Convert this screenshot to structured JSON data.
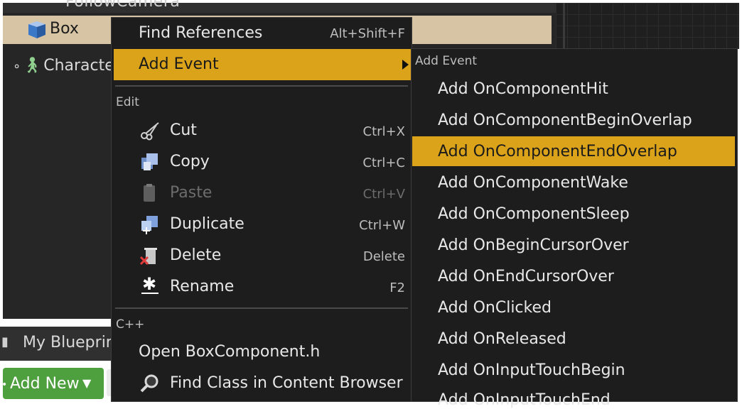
{
  "components": {
    "prev_item": "FollowCamera",
    "box": "Box",
    "character": "Character"
  },
  "my_blueprint_tab": "My Blueprin",
  "add_new_button": "Add New",
  "context_menu": {
    "find_references": {
      "label": "Find References",
      "shortcut": "Alt+Shift+F"
    },
    "add_event": {
      "label": "Add Event"
    },
    "edit_header": "Edit",
    "edit_items": [
      {
        "label": "Cut",
        "shortcut": "Ctrl+X",
        "icon": "scissors-icon"
      },
      {
        "label": "Copy",
        "shortcut": "Ctrl+C",
        "icon": "copy-icon"
      },
      {
        "label": "Paste",
        "shortcut": "Ctrl+V",
        "icon": "clipboard-icon",
        "disabled": true
      },
      {
        "label": "Duplicate",
        "shortcut": "Ctrl+W",
        "icon": "duplicate-icon"
      },
      {
        "label": "Delete",
        "shortcut": "Delete",
        "icon": "trash-icon"
      },
      {
        "label": "Rename",
        "shortcut": "F2",
        "icon": "star-icon"
      }
    ],
    "cpp_header": "C++",
    "open_file": "Open BoxComponent.h",
    "find_class": "Find Class in Content Browser"
  },
  "submenu": {
    "header": "Add Event",
    "items": [
      "Add OnComponentHit",
      "Add OnComponentBeginOverlap",
      "Add OnComponentEndOverlap",
      "Add OnComponentWake",
      "Add OnComponentSleep",
      "Add OnBeginCursorOver",
      "Add OnEndCursorOver",
      "Add OnClicked",
      "Add OnReleased",
      "Add OnInputTouchBegin",
      "Add OnInputTouchEnd"
    ],
    "highlighted_index": 2
  },
  "colors": {
    "highlight": "#dba31a",
    "menu_bg": "#1d1d1d",
    "add_new_green": "#4e9f3d"
  }
}
